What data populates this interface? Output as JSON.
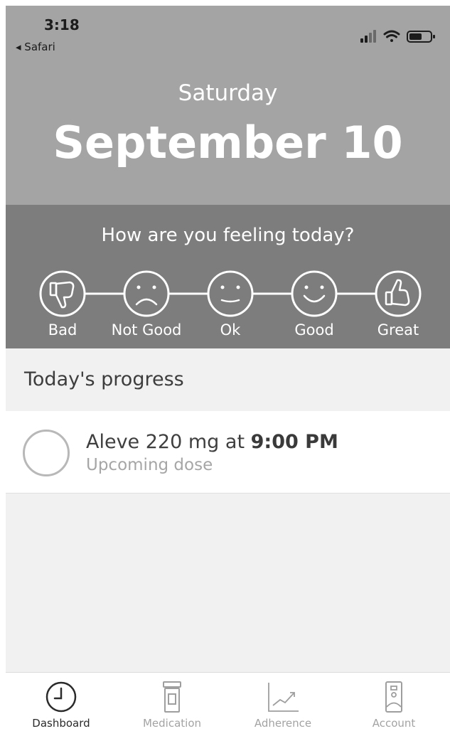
{
  "status_bar": {
    "time": "3:18",
    "back_label": "◂ Safari",
    "icons": [
      "signal-icon",
      "wifi-icon",
      "battery-icon"
    ]
  },
  "header": {
    "weekday": "Saturday",
    "date": "September 10"
  },
  "feeling": {
    "question": "How are you feeling today?",
    "options": [
      {
        "label": "Bad",
        "icon": "thumbs-down-icon"
      },
      {
        "label": "Not Good",
        "icon": "sad-face-icon"
      },
      {
        "label": "Ok",
        "icon": "neutral-face-icon"
      },
      {
        "label": "Good",
        "icon": "smile-face-icon"
      },
      {
        "label": "Great",
        "icon": "thumbs-up-icon"
      }
    ]
  },
  "progress": {
    "title": "Today's progress",
    "doses": [
      {
        "medication": "Aleve 220 mg at",
        "time": "9:00 PM",
        "status": "Upcoming dose",
        "checked": false
      }
    ]
  },
  "tabbar": {
    "tabs": [
      {
        "label": "Dashboard",
        "icon": "clock-icon",
        "active": true
      },
      {
        "label": "Medication",
        "icon": "pill-bottle-icon",
        "active": false
      },
      {
        "label": "Adherence",
        "icon": "chart-icon",
        "active": false
      },
      {
        "label": "Account",
        "icon": "id-card-icon",
        "active": false
      }
    ]
  },
  "colors": {
    "header_bg": "#a4a4a4",
    "feeling_bg": "#7d7d7d",
    "page_bg": "#f1f1f1",
    "active_tab": "#2b2b2b",
    "inactive_tab": "#a3a3a3"
  }
}
